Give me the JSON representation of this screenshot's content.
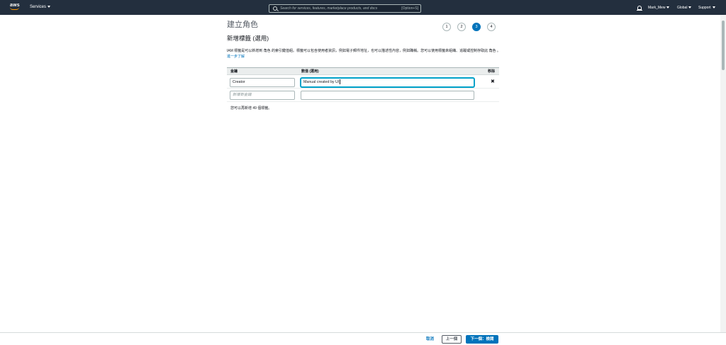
{
  "topnav": {
    "logo_text": "aws",
    "services_label": "Services",
    "search_placeholder": "Search for services, features, marketplace products, and docs",
    "search_shortcut": "[Option+S]",
    "user_label": "Mark_Mew",
    "region_label": "Global",
    "support_label": "Support"
  },
  "header": {
    "page_title": "建立角色",
    "steps": [
      "1",
      "2",
      "3",
      "4"
    ],
    "active_step": 3
  },
  "section": {
    "title": "新增標籤 (選用)",
    "description": "IAM 標籤是可以新增到 角色 的索引鍵值組。標籤可以包含使用者資訊，例如電子郵件地址，也可以描述性內容，例如職稱。您可以使用標籤來組織、追蹤或控制存取此 角色 。",
    "learn_more": "進一步了解"
  },
  "tags_table": {
    "headers": {
      "key": "金鑰",
      "value": "數值 (選用)",
      "remove": "移除"
    },
    "rows": [
      {
        "key": "Creator",
        "value": "Manual created by UI"
      }
    ],
    "new_key_placeholder": "新增新金鑰",
    "remaining_text": "您可以再新增 49 個標籤。"
  },
  "footer": {
    "cancel": "取消",
    "previous": "上一個",
    "next": "下一個：檢閱"
  },
  "colors": {
    "nav_bg": "#232f3e",
    "aws_orange": "#ff9900",
    "primary": "#0073bb",
    "focus": "#00a1c9"
  }
}
